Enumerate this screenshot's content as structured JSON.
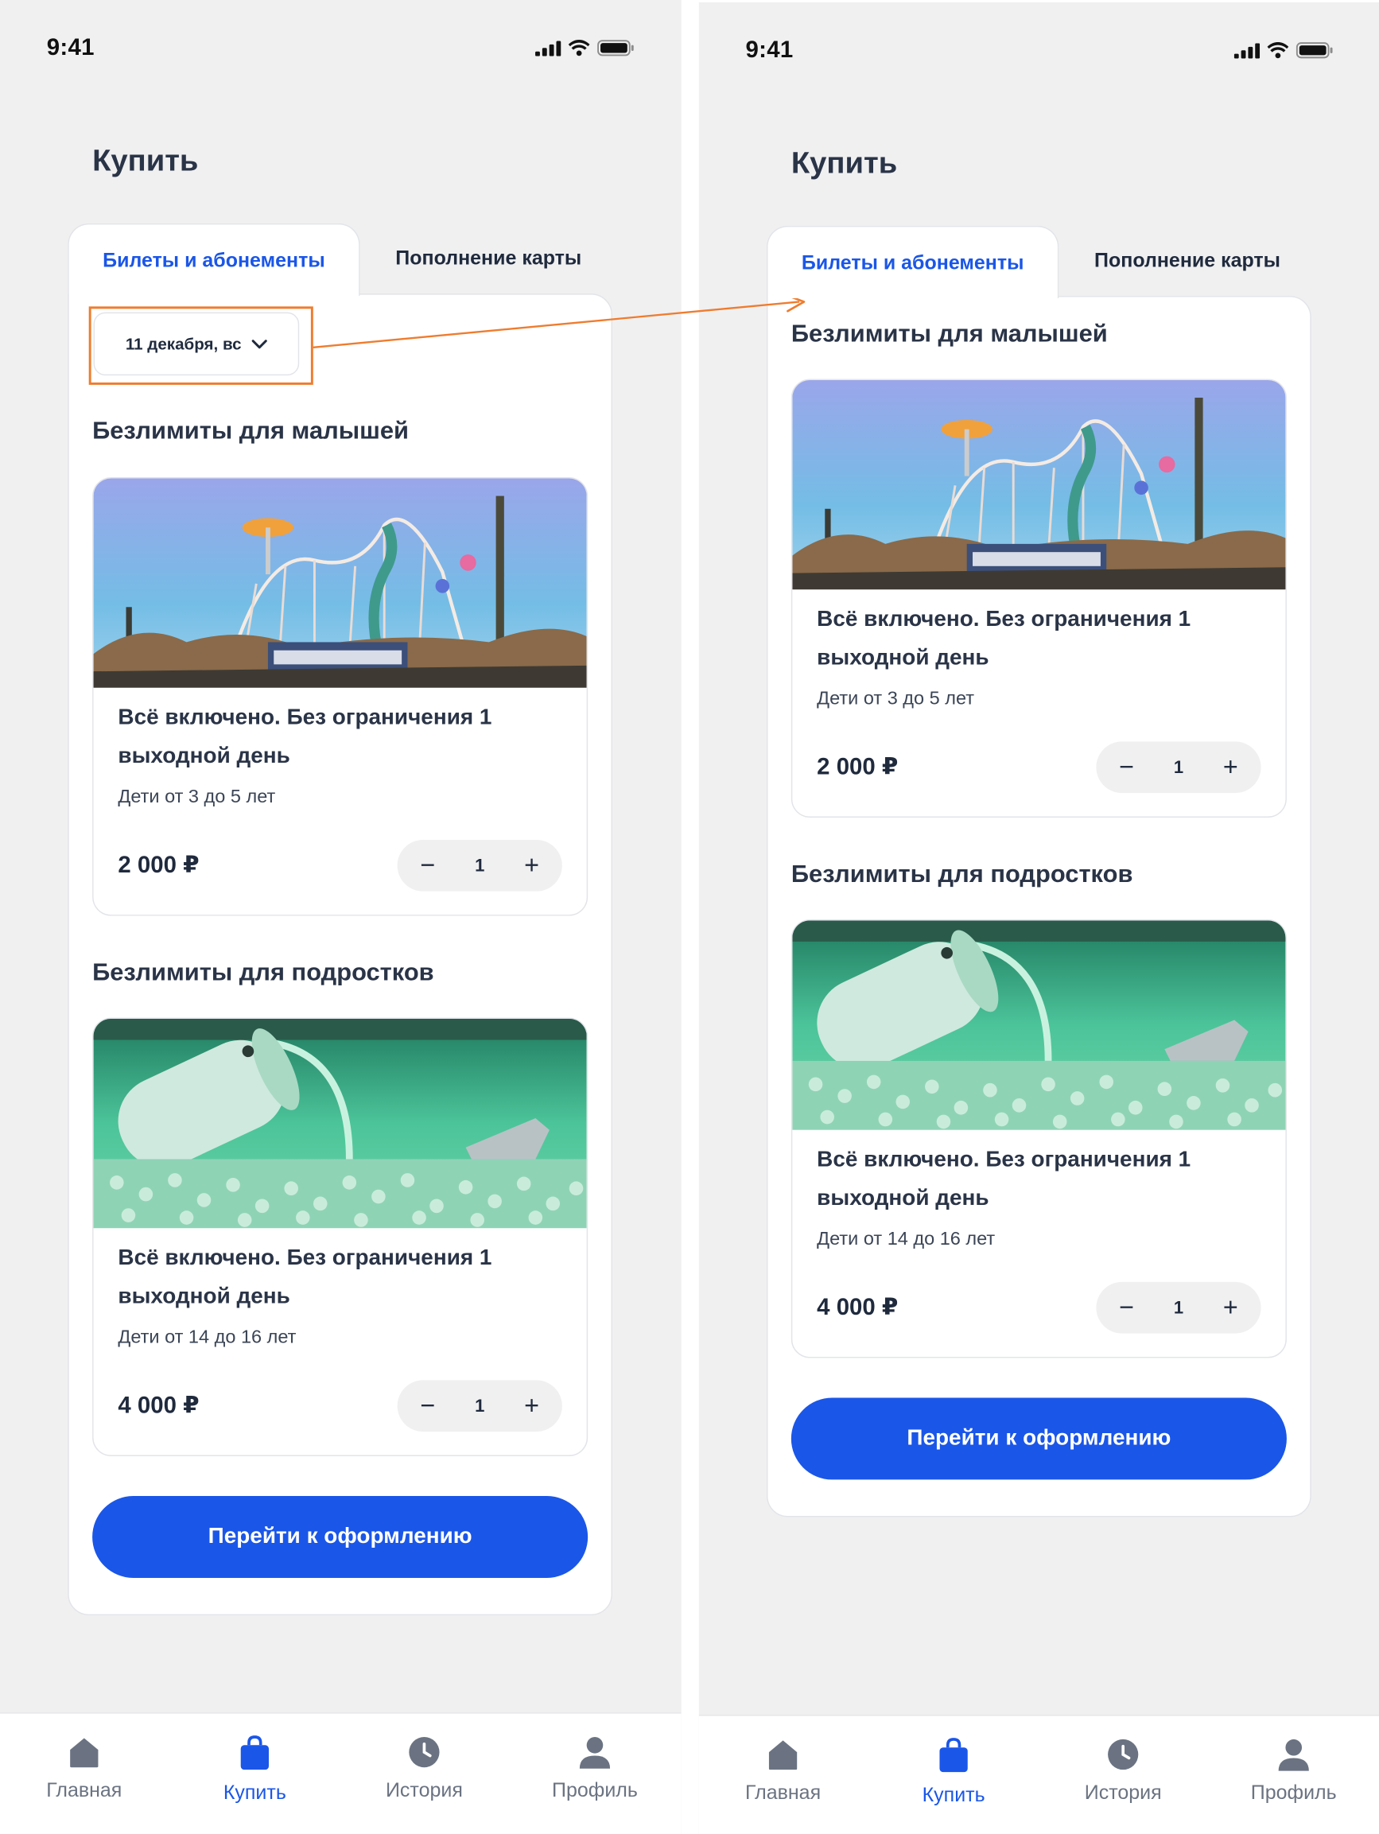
{
  "colors": {
    "accent": "#1a56e8",
    "highlight": "#ef7c2e",
    "background": "#f0f0f1",
    "text": "#1f2a3d"
  },
  "screens": [
    {
      "status": {
        "time": "9:41"
      },
      "title": "Купить",
      "tabs": [
        {
          "label": "Билеты и абонементы",
          "active": true
        },
        {
          "label": "Пополнение карты",
          "active": false
        }
      ],
      "date_selector": {
        "label": "11 декабря, вс",
        "icon": "chevron-down-icon"
      },
      "sections": [
        {
          "title": "Безлимиты для малышей",
          "card": {
            "title": "Всё включено. Без ограничения 1 выходной день",
            "subtitle": "Дети от 3 до 5 лет",
            "price": "2 000 ₽",
            "quantity": "1"
          }
        },
        {
          "title": "Безлимиты для подростков",
          "card": {
            "title": "Всё включено. Без ограничения 1 выходной день",
            "subtitle": "Дети от 14 до 16 лет",
            "price": "4 000 ₽",
            "quantity": "1"
          }
        }
      ],
      "cta": "Перейти к оформлению",
      "nav": [
        {
          "label": "Главная",
          "icon": "home-icon",
          "active": false
        },
        {
          "label": "Купить",
          "icon": "shopping-bag-icon",
          "active": true
        },
        {
          "label": "История",
          "icon": "clock-icon",
          "active": false
        },
        {
          "label": "Профиль",
          "icon": "user-icon",
          "active": false
        }
      ]
    },
    {
      "status": {
        "time": "9:41"
      },
      "title": "Купить",
      "tabs": [
        {
          "label": "Билеты и абонементы",
          "active": true
        },
        {
          "label": "Пополнение карты",
          "active": false
        }
      ],
      "sections": [
        {
          "title": "Безлимиты для малышей",
          "card": {
            "title": "Всё включено. Без ограничения 1 выходной день",
            "subtitle": "Дети от 3 до 5 лет",
            "price": "2 000 ₽",
            "quantity": "1"
          }
        },
        {
          "title": "Безлимиты для подростков",
          "card": {
            "title": "Всё включено. Без ограничения 1 выходной день",
            "subtitle": "Дети от 14 до 16 лет",
            "price": "4 000 ₽",
            "quantity": "1"
          }
        }
      ],
      "cta": "Перейти к оформлению",
      "nav": [
        {
          "label": "Главная",
          "icon": "home-icon",
          "active": false
        },
        {
          "label": "Купить",
          "icon": "shopping-bag-icon",
          "active": true
        },
        {
          "label": "История",
          "icon": "clock-icon",
          "active": false
        },
        {
          "label": "Профиль",
          "icon": "user-icon",
          "active": false
        }
      ]
    }
  ],
  "step_symbols": {
    "minus": "−",
    "plus": "+"
  }
}
